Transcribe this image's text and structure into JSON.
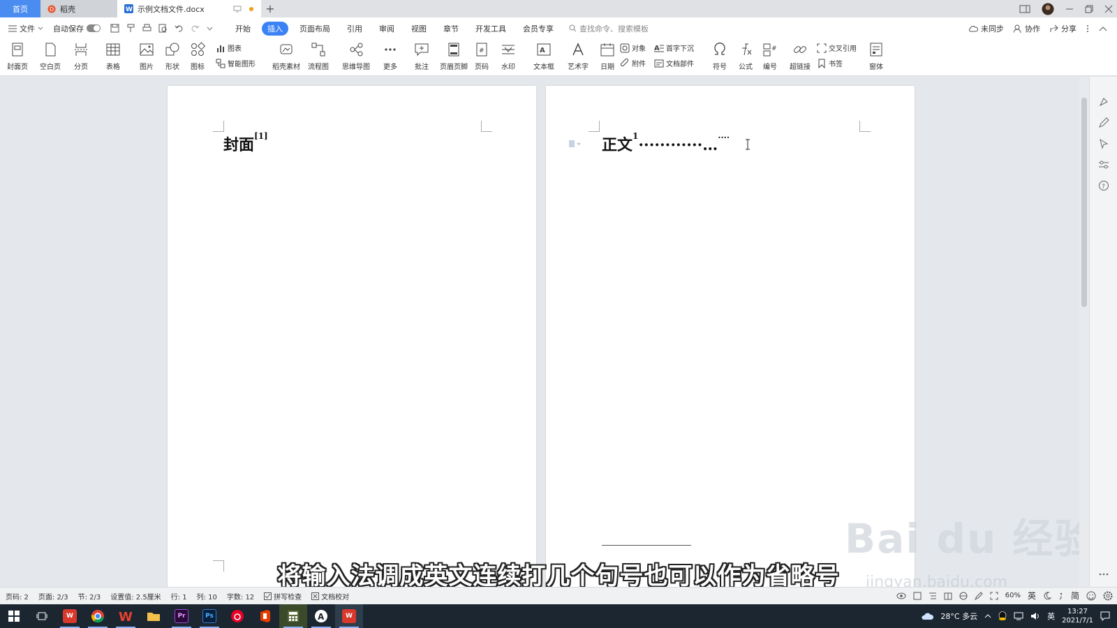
{
  "tabs": {
    "home": "首页",
    "daoke": "稻壳",
    "document": "示例文档文件.docx"
  },
  "menu": {
    "file": "文件",
    "autosave": "自动保存",
    "tabs": [
      "开始",
      "插入",
      "页面布局",
      "引用",
      "审阅",
      "视图",
      "章节",
      "开发工具",
      "会员专享"
    ],
    "active_tab": "插入",
    "search_placeholder": "查找命令、搜索模板",
    "unsynced": "未同步",
    "collaborate": "协作",
    "share": "分享"
  },
  "ribbon": {
    "cover": "封面页",
    "blank": "空白页",
    "pagebreak": "分页",
    "table": "表格",
    "picture": "图片",
    "shape": "形状",
    "icon": "图标",
    "chart": "图表",
    "smartart": "智能图形",
    "daoke_material": "稻壳素材",
    "flowchart": "流程图",
    "mindmap": "思维导图",
    "more": "更多",
    "comment": "批注",
    "header_footer": "页眉页脚",
    "page_number": "页码",
    "watermark": "水印",
    "textbox": "文本框",
    "wordart": "艺术字",
    "date": "日期",
    "object": "对象",
    "dropcap": "首字下沉",
    "attachment": "附件",
    "doc_parts": "文档部件",
    "symbol": "符号",
    "formula": "公式",
    "numbering": "编号",
    "hyperlink": "超链接",
    "crossref": "交叉引用",
    "bookmark": "书签",
    "window": "窗体"
  },
  "document": {
    "page1_text": "封面",
    "page1_sup": "[1]",
    "page2_text": "正文",
    "page2_sup": "1",
    "page2_dots": "············…",
    "page2_tail": "····"
  },
  "subtitle": "将输入法调成英文连续打几个句号也可以作为省略号",
  "watermark": {
    "brand": "Bai du 经验",
    "url": "jingyan.baidu.com"
  },
  "status": {
    "page_code": "页码: 2",
    "page": "页面: 2/3",
    "section": "节: 2/3",
    "setting": "设置值: 2.5厘米",
    "row": "行: 1",
    "col": "列: 10",
    "wordcount": "字数: 12",
    "spellcheck": "拼写检查",
    "proofread": "文档校对",
    "zoom": "60%",
    "ime_lang": "英",
    "ime_mode": "简"
  },
  "taskbar": {
    "weather": "28°C 多云",
    "ime": "英",
    "time": "13:27",
    "date": "2021/7/1",
    "apps": [
      "wps-red",
      "chrome",
      "wps-w",
      "explorer",
      "premiere",
      "photoshop",
      "netease-music",
      "office",
      "calculator",
      "app-a",
      "wps-active"
    ]
  },
  "colors": {
    "accent": "#3b82f6",
    "home_tab": "#4a8cf0",
    "taskbar": "#1b2631"
  }
}
